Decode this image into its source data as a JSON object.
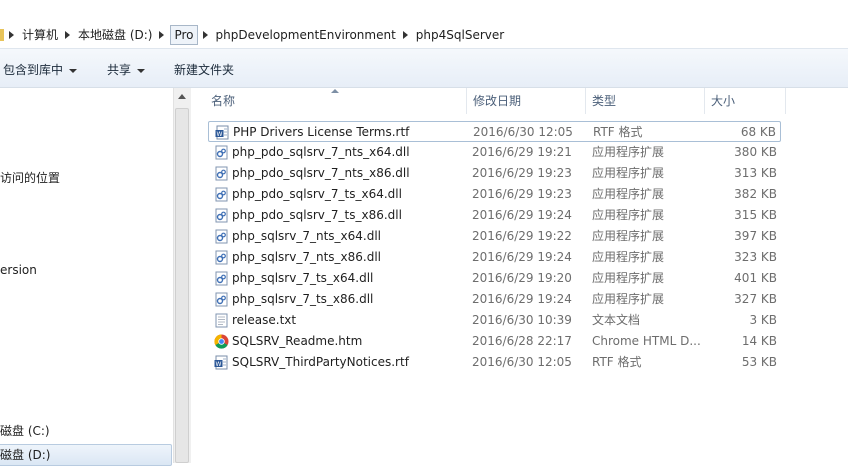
{
  "breadcrumb": {
    "items": [
      "计算机",
      "本地磁盘 (D:)",
      "Pro",
      "phpDevelopmentEnvironment",
      "php4SqlServer"
    ]
  },
  "toolbar": {
    "include_library": "包含到库中",
    "share": "共享",
    "new_folder": "新建文件夹"
  },
  "nav": {
    "recent_places": "访问的位置",
    "version": "ersion",
    "drive_c": "磁盘 (C:)",
    "drive_d": "磁盘 (D:)"
  },
  "columns": {
    "name": "名称",
    "modified": "修改日期",
    "type": "类型",
    "size": "大小"
  },
  "files": [
    {
      "name": "PHP Drivers License Terms.rtf",
      "date": "2016/6/30 12:05",
      "type": "RTF 格式",
      "size": "68 KB",
      "icon": "rtf-document-icon"
    },
    {
      "name": "php_pdo_sqlsrv_7_nts_x64.dll",
      "date": "2016/6/29 19:21",
      "type": "应用程序扩展",
      "size": "380 KB",
      "icon": "dll-file-icon"
    },
    {
      "name": "php_pdo_sqlsrv_7_nts_x86.dll",
      "date": "2016/6/29 19:23",
      "type": "应用程序扩展",
      "size": "313 KB",
      "icon": "dll-file-icon"
    },
    {
      "name": "php_pdo_sqlsrv_7_ts_x64.dll",
      "date": "2016/6/29 19:23",
      "type": "应用程序扩展",
      "size": "382 KB",
      "icon": "dll-file-icon"
    },
    {
      "name": "php_pdo_sqlsrv_7_ts_x86.dll",
      "date": "2016/6/29 19:24",
      "type": "应用程序扩展",
      "size": "315 KB",
      "icon": "dll-file-icon"
    },
    {
      "name": "php_sqlsrv_7_nts_x64.dll",
      "date": "2016/6/29 19:22",
      "type": "应用程序扩展",
      "size": "397 KB",
      "icon": "dll-file-icon"
    },
    {
      "name": "php_sqlsrv_7_nts_x86.dll",
      "date": "2016/6/29 19:24",
      "type": "应用程序扩展",
      "size": "323 KB",
      "icon": "dll-file-icon"
    },
    {
      "name": "php_sqlsrv_7_ts_x64.dll",
      "date": "2016/6/29 19:20",
      "type": "应用程序扩展",
      "size": "401 KB",
      "icon": "dll-file-icon"
    },
    {
      "name": "php_sqlsrv_7_ts_x86.dll",
      "date": "2016/6/29 19:24",
      "type": "应用程序扩展",
      "size": "327 KB",
      "icon": "dll-file-icon"
    },
    {
      "name": "release.txt",
      "date": "2016/6/30 10:39",
      "type": "文本文档",
      "size": "3 KB",
      "icon": "text-file-icon"
    },
    {
      "name": "SQLSRV_Readme.htm",
      "date": "2016/6/28 22:17",
      "type": "Chrome HTML D...",
      "size": "14 KB",
      "icon": "chrome-html-icon"
    },
    {
      "name": "SQLSRV_ThirdPartyNotices.rtf",
      "date": "2016/6/30 12:05",
      "type": "RTF 格式",
      "size": "53 KB",
      "icon": "rtf-document-icon"
    }
  ]
}
